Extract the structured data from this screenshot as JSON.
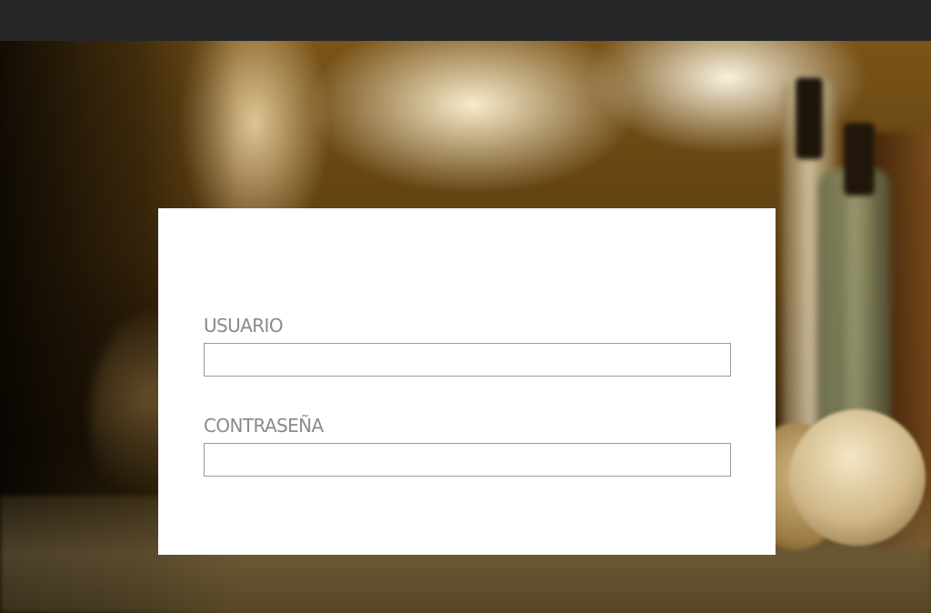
{
  "login_form": {
    "username_label": "USUARIO",
    "username_value": "",
    "password_label": "CONTRASEÑA",
    "password_value": ""
  }
}
